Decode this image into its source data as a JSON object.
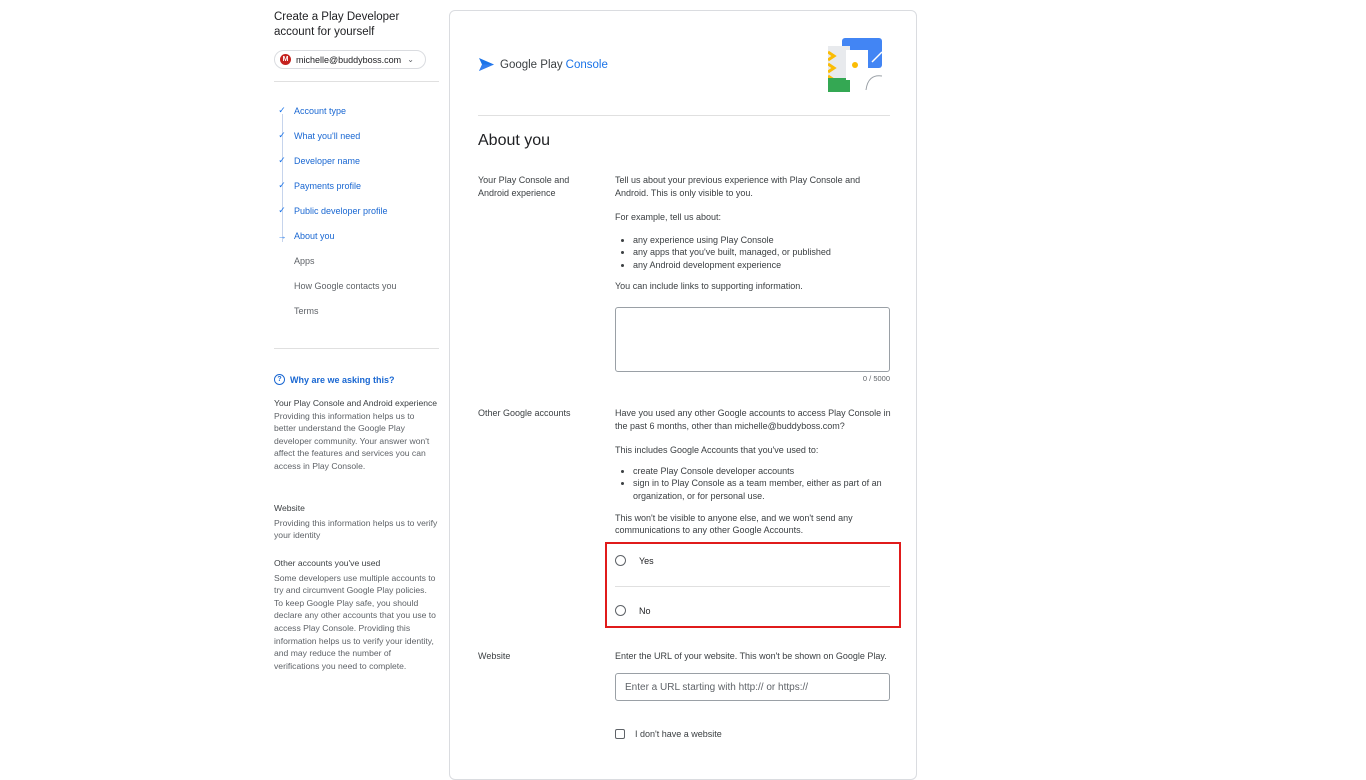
{
  "sidebar": {
    "title": "Create a Play Developer account for yourself",
    "account": {
      "avatar_letter": "M",
      "email": "michelle@buddyboss.com"
    },
    "steps": [
      {
        "label": "Account type",
        "status": "done"
      },
      {
        "label": "What you'll need",
        "status": "done"
      },
      {
        "label": "Developer name",
        "status": "done"
      },
      {
        "label": "Payments profile",
        "status": "done"
      },
      {
        "label": "Public developer profile",
        "status": "done"
      },
      {
        "label": "About you",
        "status": "current"
      },
      {
        "label": "Apps",
        "status": "todo"
      },
      {
        "label": "How Google contacts you",
        "status": "todo"
      },
      {
        "label": "Terms",
        "status": "todo"
      }
    ],
    "why_title": "Why are we asking this?",
    "help": [
      {
        "heading": "Your Play Console and Android experience",
        "text": "Providing this information helps us to better understand the Google Play developer community. Your answer won't affect the features and services you can access in Play Console."
      },
      {
        "heading": "Website",
        "text": "Providing this information helps us to verify your identity"
      },
      {
        "heading": "Other accounts you've used",
        "text": "Some developers use multiple accounts to try and circumvent Google Play policies. To keep Google Play safe, you should declare any other accounts that you use to access Play Console. Providing this information helps us to verify your identity, and may reduce the number of verifications you need to complete."
      }
    ]
  },
  "header": {
    "brand_prefix": "Google Play",
    "brand_suffix": "Console"
  },
  "main": {
    "title": "About you",
    "experience": {
      "label": "Your Play Console and Android experience",
      "intro": "Tell us about your previous experience with Play Console and Android. This is only visible to you.",
      "example": "For example, tell us about:",
      "bullets": [
        "any experience using Play Console",
        "any apps that you've built, managed, or published",
        "any Android development experience"
      ],
      "links_note": "You can include links to supporting information.",
      "counter": "0 / 5000"
    },
    "other_accounts": {
      "label": "Other Google accounts",
      "question": "Have you used any other Google accounts to access Play Console in the past 6 months, other than michelle@buddyboss.com?",
      "includes": "This includes Google Accounts that you've used to:",
      "bullets": [
        "create Play Console developer accounts",
        "sign in to Play Console as a team member, either as part of an organization, or for personal use."
      ],
      "visibility": "This won't be visible to anyone else, and we won't send any communications to any other Google Accounts.",
      "option_yes": "Yes",
      "option_no": "No"
    },
    "website": {
      "label": "Website",
      "description": "Enter the URL of your website. This won't be shown on Google Play.",
      "placeholder": "Enter a URL starting with http:// or https://",
      "no_website": "I don't have a website"
    }
  },
  "colors": {
    "accent": "#1a73e8",
    "highlight": "#e01b1b"
  }
}
